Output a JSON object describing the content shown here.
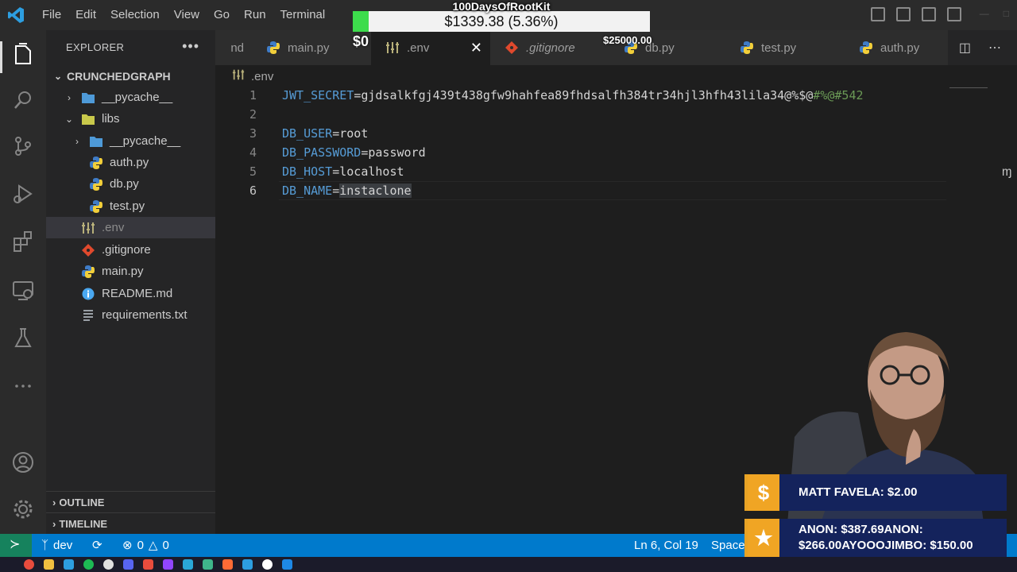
{
  "menu": [
    "File",
    "Edit",
    "Selection",
    "View",
    "Go",
    "Run",
    "Terminal"
  ],
  "sidebar": {
    "title": "EXPLORER",
    "root": "CRUNCHEDGRAPH",
    "items": [
      {
        "label": "__pycache__"
      },
      {
        "label": "libs"
      },
      {
        "label": "__pycache__"
      },
      {
        "label": "auth.py"
      },
      {
        "label": "db.py"
      },
      {
        "label": "test.py"
      },
      {
        "label": ".env"
      },
      {
        "label": ".gitignore"
      },
      {
        "label": "main.py"
      },
      {
        "label": "README.md"
      },
      {
        "label": "requirements.txt"
      }
    ],
    "outline": "OUTLINE",
    "timeline": "TIMELINE"
  },
  "tabs": [
    {
      "label": "nd"
    },
    {
      "label": "main.py"
    },
    {
      "label": ".env"
    },
    {
      "label": ".gitignore"
    },
    {
      "label": "db.py"
    },
    {
      "label": "test.py"
    },
    {
      "label": "auth.py"
    }
  ],
  "breadcrumb": ".env",
  "editor": {
    "lines": [
      {
        "n": "1",
        "key": "JWT_SECRET",
        "eq": "=",
        "val": "gjdsalkfgj439t438gfw9hahfea89fhdsalfh384tr34hjl3hfh43lila34@%$@",
        "val_tail": "#%@#542"
      },
      {
        "n": "2"
      },
      {
        "n": "3",
        "key": "DB_USER",
        "eq": "=",
        "val": "root"
      },
      {
        "n": "4",
        "key": "DB_PASSWORD",
        "eq": "=",
        "val": "password"
      },
      {
        "n": "5",
        "key": "DB_HOST",
        "eq": "=",
        "val": "localhost"
      },
      {
        "n": "6",
        "key": "DB_NAME",
        "eq": "=",
        "val": "instaclone"
      }
    ]
  },
  "status": {
    "branch": "dev",
    "errors": "0",
    "warnings": "0",
    "position": "Ln 6, Col 19",
    "spaces": "Spaces"
  },
  "overlay": {
    "goal_title": "100DaysOfRootKit",
    "goal_amount": "$1339.38 (5.36%)",
    "goal_progress": 0.0536,
    "goal_min": "$0",
    "goal_max": "$25000.00",
    "alert1": "MATT FAVELA: $2.00",
    "alert2": "ANON: $387.69ANON: $266.00AYOOOJIMBO: $150.00"
  },
  "colors": {
    "accent": "#007acc",
    "remote": "#16825d",
    "goal_fill": "#3ddc4c",
    "alert_bg": "#14235c",
    "alert_badge": "#f0a524"
  }
}
